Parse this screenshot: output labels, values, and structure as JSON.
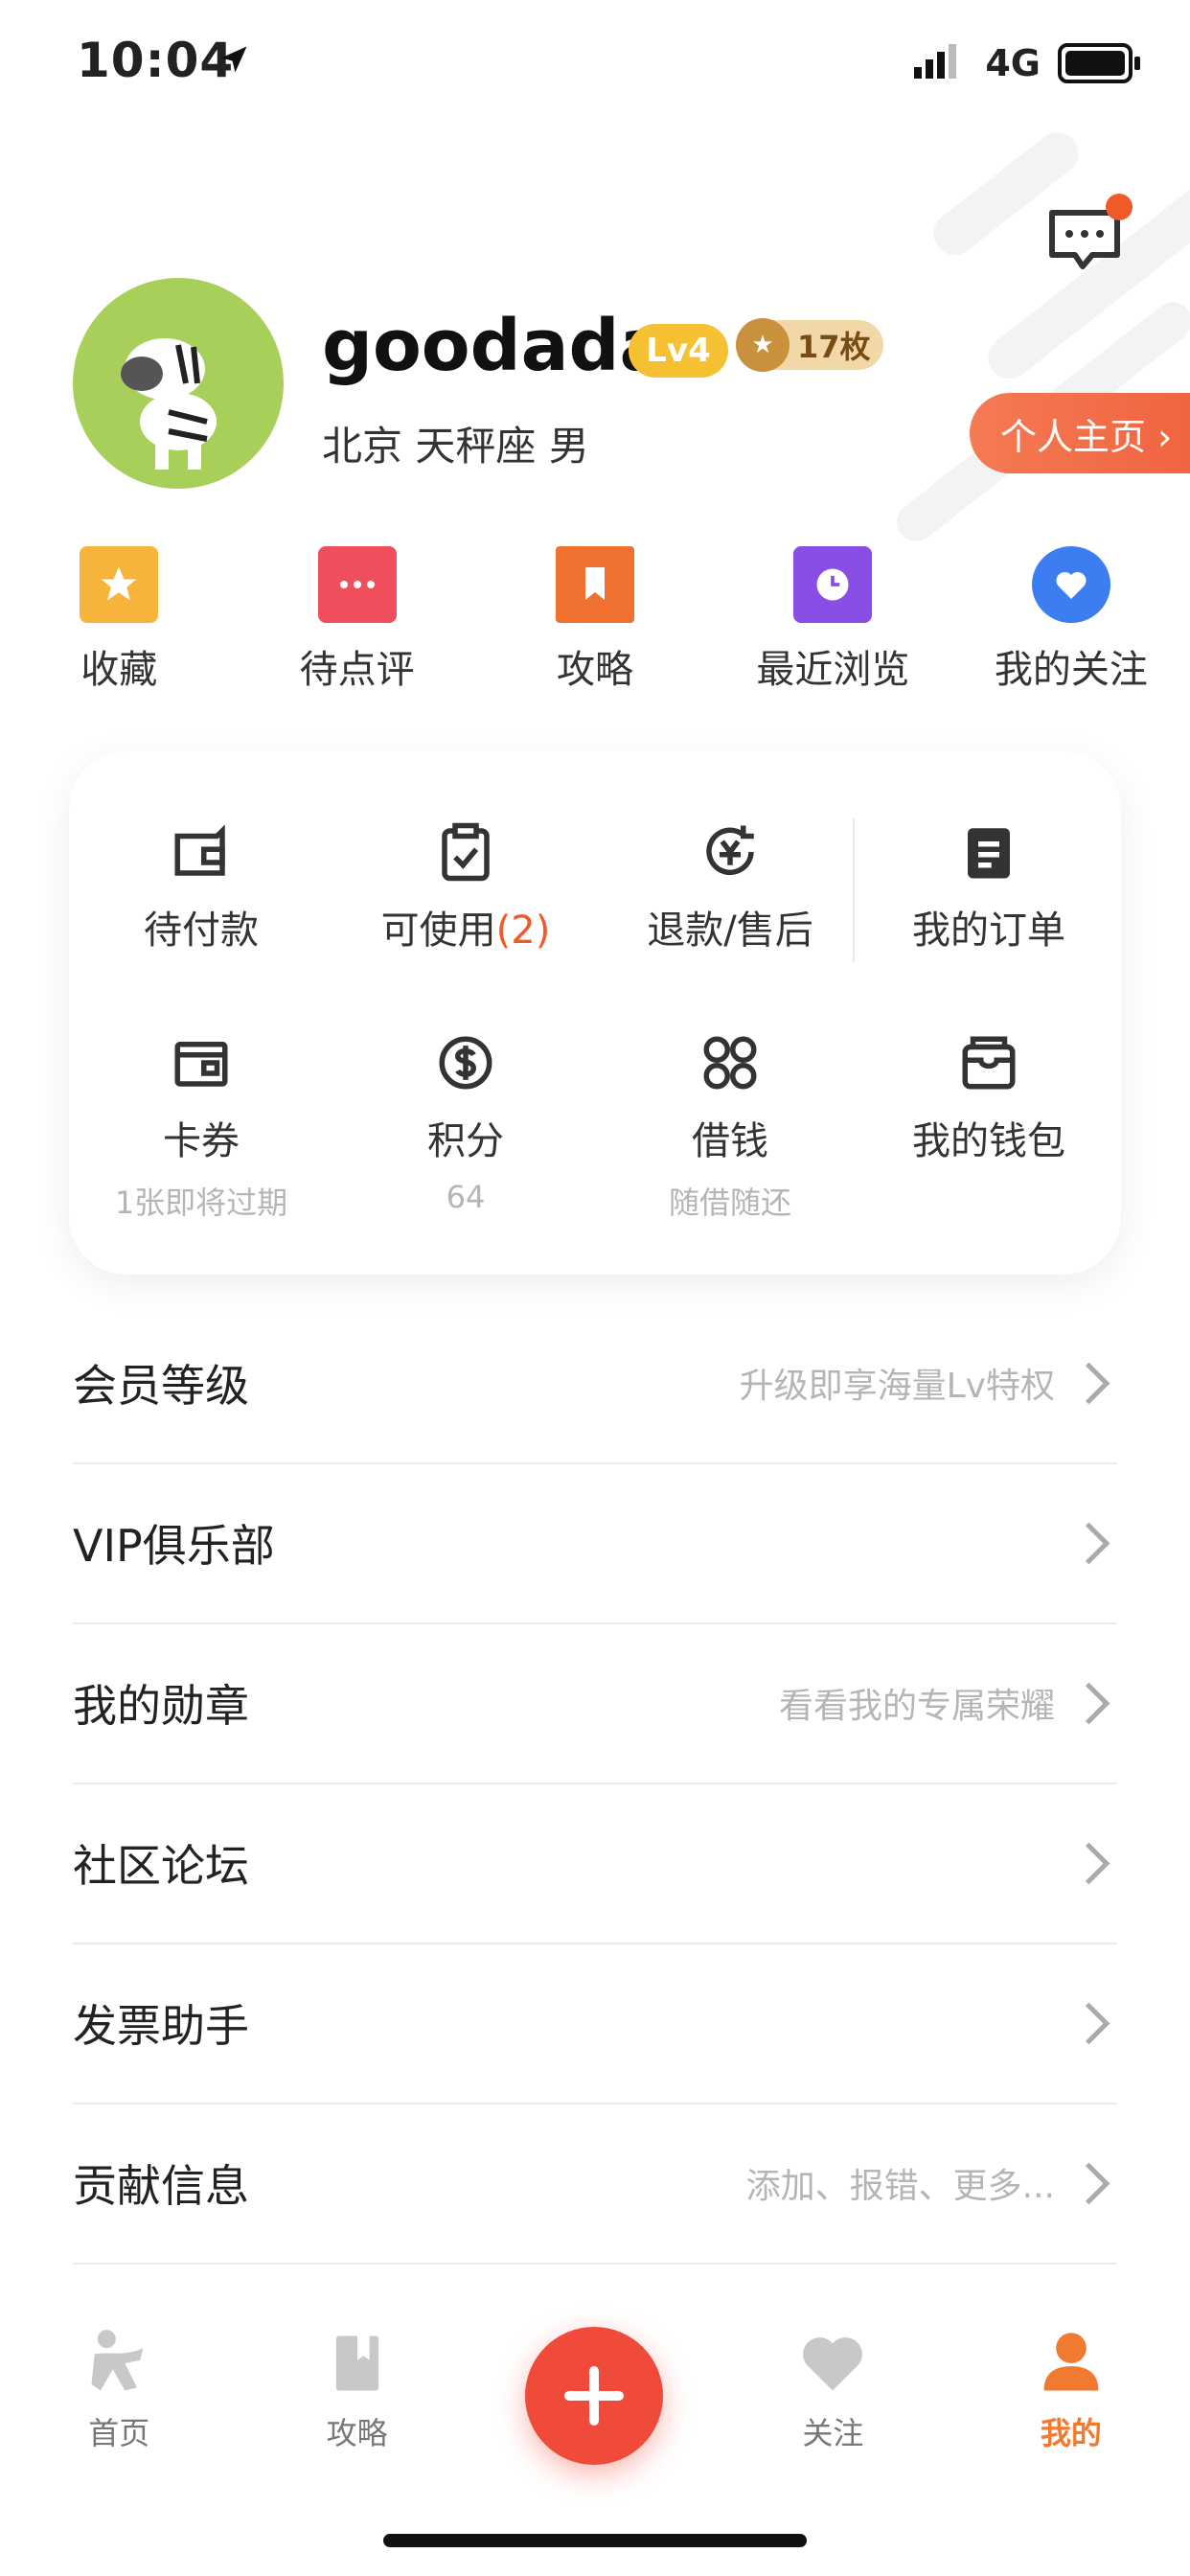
{
  "status_bar": {
    "time": "10:04",
    "network": "4G"
  },
  "profile": {
    "username": "goodada",
    "level": "Lv4",
    "medal_count": "17枚",
    "info": "北京 天秤座 男",
    "homepage_button": "个人主页 ›"
  },
  "shortcuts": [
    {
      "label": "收藏",
      "icon": "star-icon",
      "color": "#f6b53a"
    },
    {
      "label": "待点评",
      "icon": "comment-icon",
      "color": "#ef4f5d"
    },
    {
      "label": "攻略",
      "icon": "bookmark-icon",
      "color": "#f07030"
    },
    {
      "label": "最近浏览",
      "icon": "clock-icon",
      "color": "#8a4ee6"
    },
    {
      "label": "我的关注",
      "icon": "heart-icon",
      "color": "#3d7df2"
    }
  ],
  "orders": {
    "pending_payment": "待付款",
    "usable_label": "可使用",
    "usable_count": "(2)",
    "refund": "退款/售后",
    "my_orders": "我的订单"
  },
  "wallet": {
    "coupons": "卡券",
    "coupons_sub": "1张即将过期",
    "points": "积分",
    "points_sub": "64",
    "loan": "借钱",
    "loan_sub": "随借随还",
    "my_wallet": "我的钱包"
  },
  "menu": [
    {
      "title": "会员等级",
      "hint": "升级即享海量Lv特权"
    },
    {
      "title": "VIP俱乐部",
      "hint": ""
    },
    {
      "title": "我的勋章",
      "hint": "看看我的专属荣耀"
    },
    {
      "title": "社区论坛",
      "hint": ""
    },
    {
      "title": "发票助手",
      "hint": ""
    },
    {
      "title": "贡献信息",
      "hint": "添加、报错、更多..."
    }
  ],
  "tabbar": {
    "home": "首页",
    "guide": "攻略",
    "follow": "关注",
    "mine": "我的"
  },
  "colors": {
    "accent": "#f07a30",
    "fab": "#f04a3a"
  }
}
